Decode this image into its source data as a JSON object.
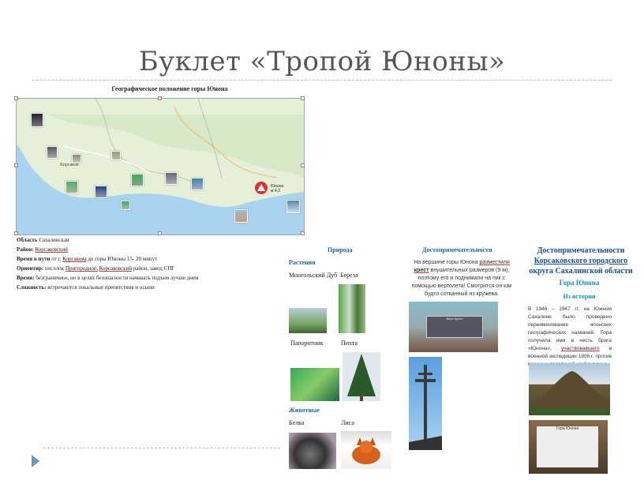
{
  "title": "Буклет «Тропой Юноны»",
  "map": {
    "caption": "Географическое положение горы Юнона",
    "city_label": "Корсаков",
    "peak_label": "Юнона",
    "peak_height": "м 4,3"
  },
  "info": {
    "region_k": "Область",
    "region_v": "Сахалинская",
    "district_k": "Район:",
    "district_v": "Корсаковский",
    "time_k": "Время в пути",
    "time_v1": "от г.",
    "time_v2": "Корсакова",
    "time_v3": "до горы Юноны 15- 20  минут",
    "landmark_k": "Ориентир:",
    "landmark_v1": "поселок",
    "landmark_v2": "Пригородное,",
    "landmark_v3": "Корсаковский",
    "landmark_v4": "район, завод СПГ",
    "season_k": "Время:",
    "season_v": "безграничное, но в целях безопасности начинать подъем лучше днем",
    "difficulty_k": "Сложность:",
    "difficulty_v": "встречаются локальные препятствия и осыпи"
  },
  "nature": {
    "heading": "Природа",
    "plants": "Растения",
    "oak": "Монгольский Дуб",
    "birch": "Береза",
    "fern": "Папоротник",
    "fir": "Пихта",
    "animals": "Животные",
    "squirrel": "Белка",
    "fox": "Лиса"
  },
  "sights": {
    "heading": "Достопримечательности",
    "text_a": "На вершине горы Юнона",
    "text_b": "разместили",
    "text_c": "крест",
    "text_d": "внушительных размеров (9 м), поэтому его и поднимали на пик с помощью вертолета! Смотрится он как будто сотканный из кружева.",
    "plaque": "Верх Крест"
  },
  "district": {
    "heading_1": "Достопримечательности",
    "heading_2": "Корсаковского городского",
    "heading_3": "округа Сахалинской области",
    "mountain": "Гора Юнона",
    "history": "Из истории",
    "text_a": "В 1946 – 1947 гг. на Южном Сахалине было проведено переименование японских географических названий. Гора получила имя в честь брига «Юнона»,",
    "text_b": "участвовавшего",
    "text_c": "в военной экспедиции 1806 г. против военных поселений на Сахалине.",
    "sign": "Гора Юнона"
  }
}
